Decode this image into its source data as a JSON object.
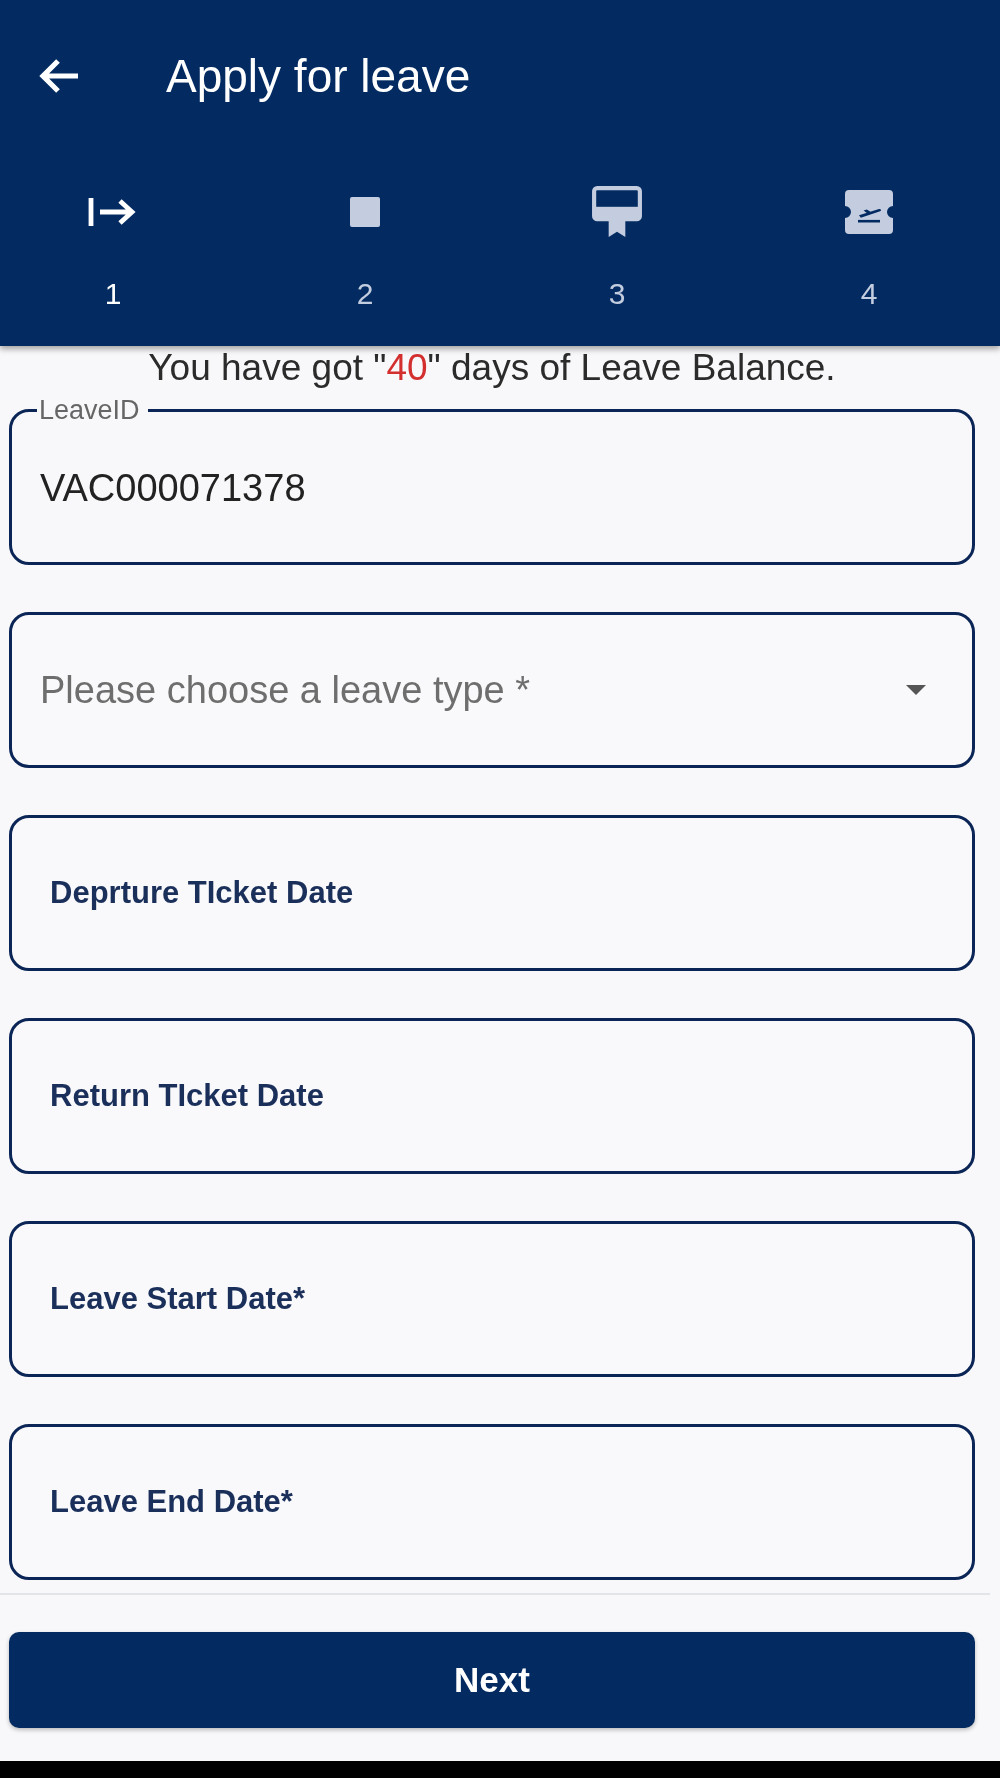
{
  "app_bar": {
    "title": "Apply for leave"
  },
  "steps": [
    {
      "number": "1",
      "selected": true
    },
    {
      "number": "2",
      "selected": false
    },
    {
      "number": "3",
      "selected": false
    },
    {
      "number": "4",
      "selected": false
    }
  ],
  "balance": {
    "text_before": "You have got \"",
    "days": "40",
    "text_after": "\" days of Leave Balance."
  },
  "fields": [
    {
      "kind": "text",
      "label": "LeaveID",
      "value": "VAC000071378"
    },
    {
      "kind": "select",
      "placeholder": "Please choose a leave type *"
    },
    {
      "kind": "date",
      "label": "Deprture TIcket Date"
    },
    {
      "kind": "date",
      "label": "Return TIcket Date"
    },
    {
      "kind": "date",
      "label": "Leave Start Date*"
    },
    {
      "kind": "date",
      "label": "Leave End Date*"
    }
  ],
  "next_button": {
    "label": "Next"
  }
}
